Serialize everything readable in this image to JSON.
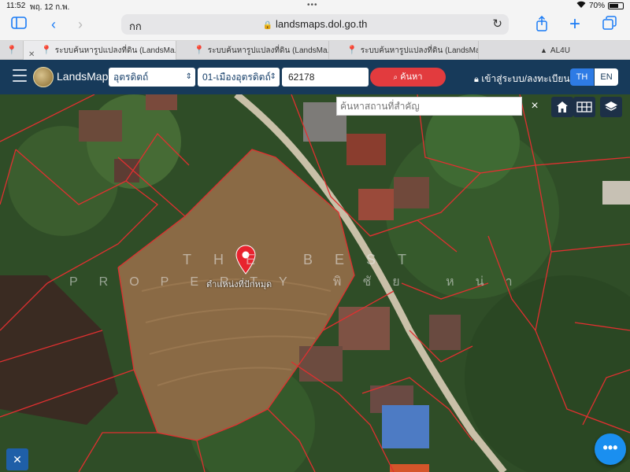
{
  "status_bar": {
    "time": "11:52",
    "date": "พฤ. 12 ก.พ.",
    "battery": "70%",
    "battery_level": 0.7,
    "wifi_icon": "wifi-icon"
  },
  "safari": {
    "reader_label": "กก",
    "url": "landsmaps.dol.go.th",
    "icons": [
      "sidebar-icon",
      "back-icon",
      "forward-icon",
      "lock-icon",
      "reload-icon",
      "share-icon",
      "new-tab-icon",
      "tabs-icon"
    ]
  },
  "tabs": [
    {
      "label": "ระบบค้นหารูปแปลงที่ดิน (LandsMa...",
      "icon": "map-pin-icon"
    },
    {
      "label": "ระบบค้นหารูปแปลงที่ดิน (LandsMa...",
      "icon": "map-pin-icon"
    },
    {
      "label": "ระบบค้นหารูปแปลงที่ดิน (LandsMa...",
      "icon": "map-pin-icon"
    },
    {
      "label": "AL4U",
      "icon": "triangle-icon"
    }
  ],
  "appbar": {
    "brand": "LandsMaps",
    "province": "อุตรดิตถ์",
    "district": "01-เมืองอุตรดิตถ์",
    "parcel_number": "62178",
    "search_label": "ค้นหา",
    "login_label": "เข้าสู่ระบบ/ลงทะเบียน",
    "lang_th": "TH",
    "lang_en": "EN",
    "accent": "#e23b3e",
    "bar_color": "#173a5a"
  },
  "map": {
    "place_search_placeholder": "ค้นหาสถานที่สำคัญ",
    "clear_label": "×",
    "watermark_line1": "THE BEST",
    "watermark_line2": "PROPERTY พิชัย หน่า",
    "pin_label": "ตำแหน่งที่ปักหมุด",
    "pin_color": "#e8232e",
    "boundary_color": "#e03030",
    "fab_label": "•••",
    "tools": [
      "home-icon",
      "grid-icon",
      "layers-icon"
    ]
  }
}
